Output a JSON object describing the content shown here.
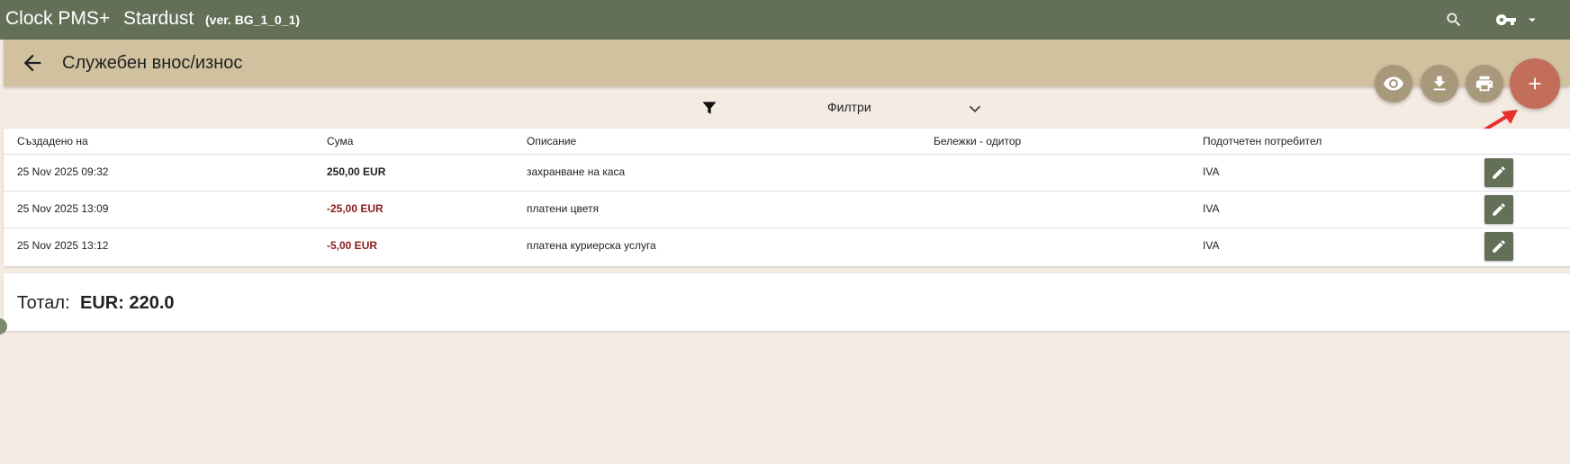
{
  "app": {
    "name": "Clock PMS+",
    "hotel": "Stardust",
    "version": "(ver. BG_1_0_1)"
  },
  "topbar_icons": [
    "search-icon",
    "key-icon",
    "caret-down-icon"
  ],
  "page": {
    "title": "Служебен внос/износ"
  },
  "actions": [
    "eye-icon",
    "download-icon",
    "print-icon",
    "plus-icon"
  ],
  "filter": {
    "label": "Филтри"
  },
  "table": {
    "headers": [
      "Създадено на",
      "Сума",
      "Описание",
      "Бележки - одитор",
      "Подотчетен потребител"
    ],
    "rows": [
      {
        "created": "25 Nov 2025 09:32",
        "amount": "250,00 EUR",
        "description": "захранване на каса",
        "notes": "",
        "user": "IVA"
      },
      {
        "created": "25 Nov 2025 13:09",
        "amount": "-25,00 EUR",
        "description": "платени цветя",
        "notes": "",
        "user": "IVA"
      },
      {
        "created": "25 Nov 2025 13:12",
        "amount": "-5,00 EUR",
        "description": "платена куриерска услуга",
        "notes": "",
        "user": "IVA"
      }
    ]
  },
  "total": {
    "label": "Тотал:",
    "value": "EUR: 220.0"
  },
  "colors": {
    "topbar": "#636f57",
    "header": "#d1c19e",
    "background": "#f4ebe3",
    "add_button": "#c26e5a",
    "negative_amount": "#8b1c1c"
  }
}
